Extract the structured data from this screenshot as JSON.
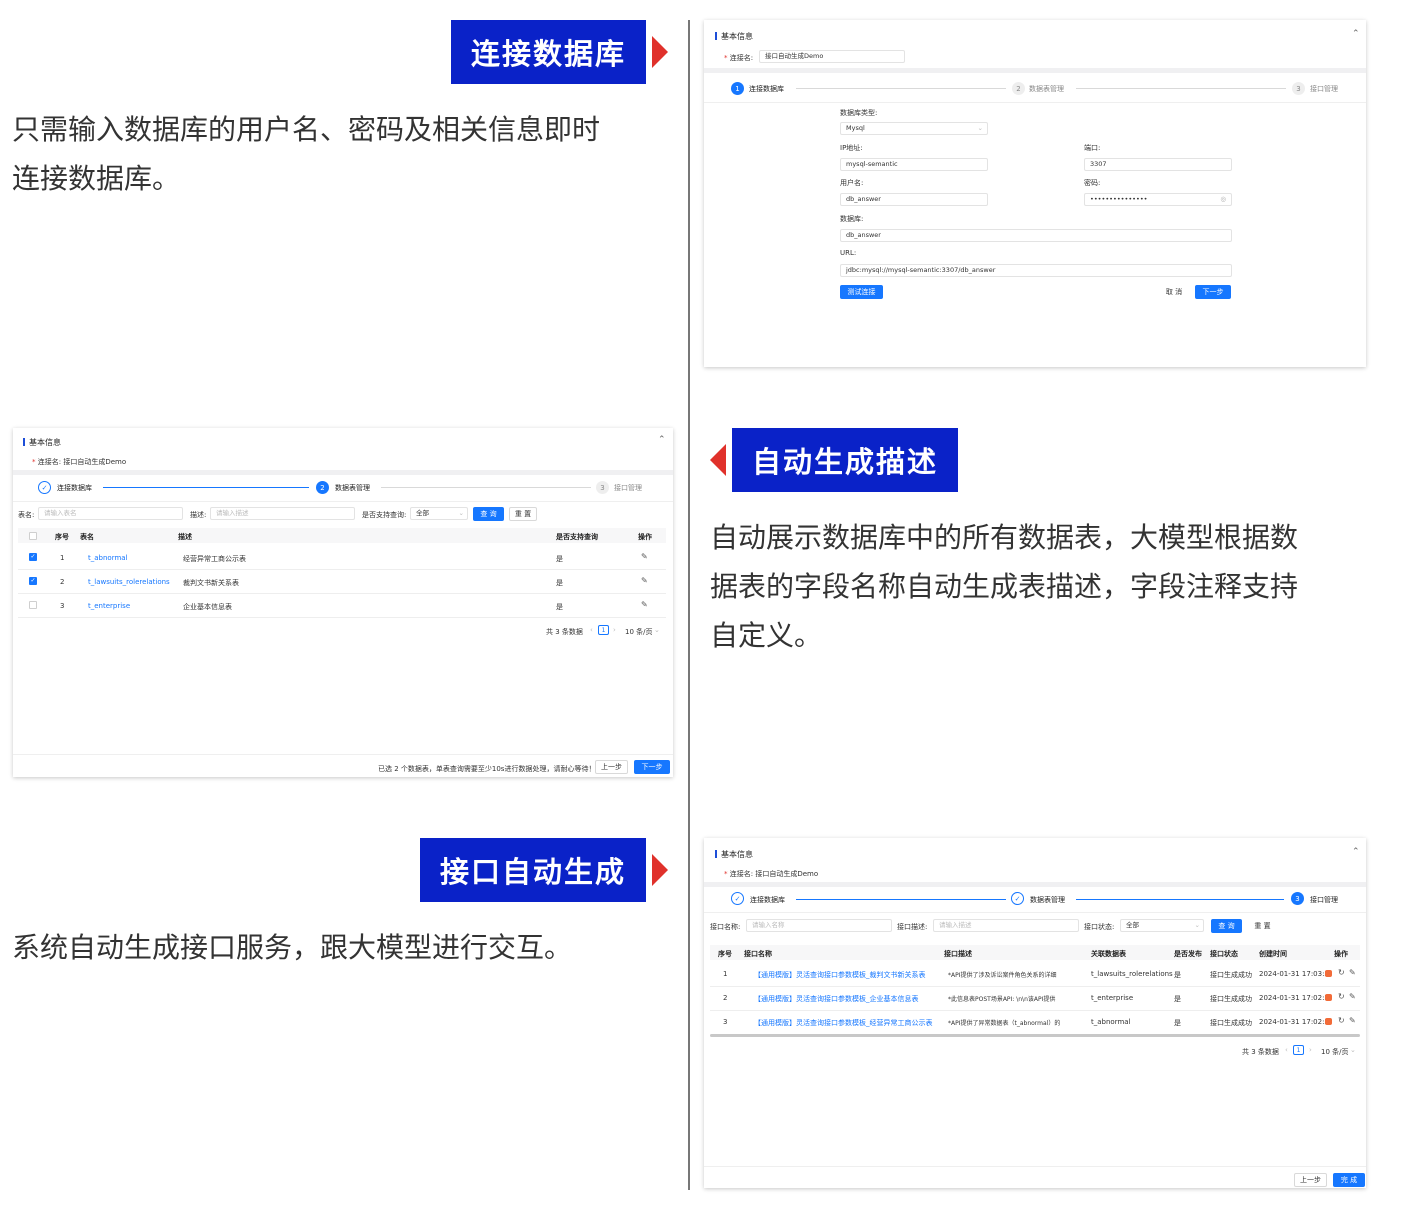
{
  "sections": {
    "connect": {
      "title": "连接数据库",
      "desc_lines": [
        "只需输入数据库的用户名、密码及相关信息即时",
        "连接数据库。"
      ]
    },
    "describe": {
      "title": "自动生成描述",
      "desc_lines": [
        "自动展示数据库中的所有数据表，大模型根据数",
        "据表的字段名称自动生成表描述，字段注释支持",
        "自定义。"
      ]
    },
    "generate": {
      "title": "接口自动生成",
      "desc_lines": [
        "系统自动生成接口服务，跟大模型进行交互。"
      ]
    }
  },
  "common": {
    "basic_info": "基本信息",
    "conn_name_label": "连接名:",
    "conn_name_value": "接口自动生成Demo",
    "collapse_icon": "chevron-up",
    "steps": [
      {
        "num": "1",
        "label": "连接数据库"
      },
      {
        "num": "2",
        "label": "数据表管理"
      },
      {
        "num": "3",
        "label": "接口管理"
      }
    ]
  },
  "panel1": {
    "db_type_label": "数据库类型:",
    "db_type_value": "Mysql",
    "ip_label": "IP地址:",
    "ip_value": "mysql-semantic",
    "port_label": "端口:",
    "port_value": "3307",
    "user_label": "用户名:",
    "user_value": "db_answer",
    "password_label": "密码:",
    "password_value": "•••••••••••••••",
    "db_label": "数据库:",
    "db_value": "db_answer",
    "url_label": "URL:",
    "url_value": "jdbc:mysql://mysql-semantic:3307/db_answer",
    "test_btn": "测试连接",
    "cancel_btn": "取 消",
    "next_btn": "下一步"
  },
  "panel2": {
    "table_name_label": "表名:",
    "table_name_ph": "请输入表名",
    "desc_label": "描述:",
    "desc_ph": "请输入描述",
    "support_label": "是否支持查询:",
    "support_value": "全部",
    "query_btn": "查 询",
    "reset_btn": "重 置",
    "headers": [
      "序号",
      "表名",
      "描述",
      "是否支持查询",
      "操作"
    ],
    "rows": [
      {
        "no": "1",
        "name": "t_abnormal",
        "desc": "经营异常工商公示表",
        "support": "是",
        "checked": true
      },
      {
        "no": "2",
        "name": "t_lawsuits_rolerelations",
        "desc": "裁判文书新关系表",
        "support": "是",
        "checked": true
      },
      {
        "no": "3",
        "name": "t_enterprise",
        "desc": "企业基本信息表",
        "support": "是",
        "checked": false
      }
    ],
    "total": "共 3 条数据",
    "page": "1",
    "page_size": "10 条/页",
    "footer_note": "已选 2 个数据表，单表查询需要至少10s进行数据处理，请耐心等待！",
    "prev_btn": "上一步",
    "next_btn": "下一步"
  },
  "panel3": {
    "api_name_label": "接口名称:",
    "api_name_ph": "请输入名称",
    "api_desc_label": "接口描述:",
    "api_desc_ph": "请输入描述",
    "api_status_label": "接口状态:",
    "api_status_value": "全部",
    "query_btn": "查 询",
    "reset_btn": "重 置",
    "headers": [
      "序号",
      "接口名称",
      "接口描述",
      "关联数据表",
      "是否发布",
      "接口状态",
      "创建时间",
      "操作"
    ],
    "rows": [
      {
        "no": "1",
        "name": "【通用模版】灵活查询接口参数模板_裁判文书新关系表",
        "desc": "*API提供了涉及诉讼案件角色关系的详细",
        "table": "t_lawsuits_rolerelations",
        "pub": "是",
        "status": "接口生成成功",
        "time": "2024-01-31 17:03:3"
      },
      {
        "no": "2",
        "name": "【通用模版】灵活查询接口参数模板_企业基本信息表",
        "desc": "*此信息表POST场景API: \\n\\n该API提供",
        "table": "t_enterprise",
        "pub": "是",
        "status": "接口生成成功",
        "time": "2024-01-31 17:02:5"
      },
      {
        "no": "3",
        "name": "【通用模版】灵活查询接口参数模板_经营异常工商公示表",
        "desc": "*API提供了异常数据表（t_abnormal）的",
        "table": "t_abnormal",
        "pub": "是",
        "status": "接口生成成功",
        "time": "2024-01-31 17:02:3"
      }
    ],
    "total": "共 3 条数据",
    "page": "1",
    "page_size": "10 条/页",
    "prev_btn": "上一步",
    "finish_btn": "完 成"
  }
}
